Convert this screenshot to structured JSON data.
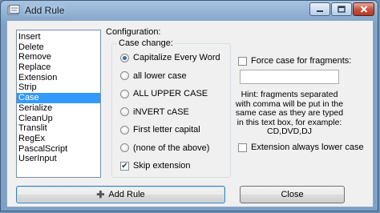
{
  "window": {
    "title": "Add Rule",
    "controls": {
      "minimize": "—",
      "maximize": "□",
      "close": "✕"
    }
  },
  "rules": [
    "Insert",
    "Delete",
    "Remove",
    "Replace",
    "Extension",
    "Strip",
    "Case",
    "Serialize",
    "CleanUp",
    "Translit",
    "RegEx",
    "PascalScript",
    "UserInput"
  ],
  "selected_rule": "Case",
  "config": {
    "label": "Configuration:",
    "case_change": {
      "legend": "Case change:",
      "options": [
        "Capitalize Every Word",
        "all lower case",
        "ALL UPPER CASE",
        "iNVERT cASE",
        "First letter capital",
        "(none of the above)"
      ],
      "selected": "Capitalize Every Word",
      "skip_extension": {
        "label": "Skip extension",
        "checked": true
      }
    },
    "force_case": {
      "label": "Force case for fragments:",
      "checked": false
    },
    "fragments_value": "",
    "hint": "Hint: fragments separated with comma will be put in the same case as they are typed in this text box, for example: CD,DVD,DJ",
    "extension_lower": {
      "label": "Extension always lower case",
      "checked": false
    }
  },
  "buttons": {
    "add_rule": "Add Rule",
    "close": "Close"
  },
  "icons": {
    "add": "plus-icon",
    "app": "app-icon"
  }
}
